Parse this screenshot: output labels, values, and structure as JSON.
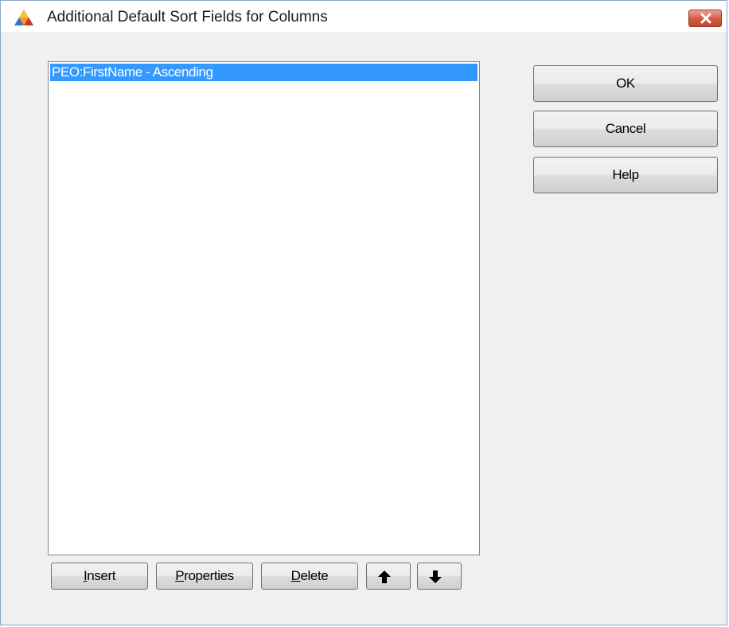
{
  "window": {
    "title": "Additional Default Sort Fields for Columns",
    "icon": "app-triangle-icon",
    "close_icon": "close-icon"
  },
  "list": {
    "items": [
      {
        "label": "PEO:FirstName - Ascending",
        "selected": true
      }
    ]
  },
  "buttons": {
    "ok": "OK",
    "cancel": "Cancel",
    "help": "Help",
    "insert": {
      "mnemonic": "I",
      "rest": "nsert"
    },
    "properties": {
      "mnemonic": "P",
      "rest": "roperties"
    },
    "delete": {
      "mnemonic": "D",
      "rest": "elete"
    },
    "move_up_icon": "arrow-up-icon",
    "move_down_icon": "arrow-down-icon"
  },
  "colors": {
    "selection": "#3399ff",
    "close_button": "#c7503a"
  }
}
